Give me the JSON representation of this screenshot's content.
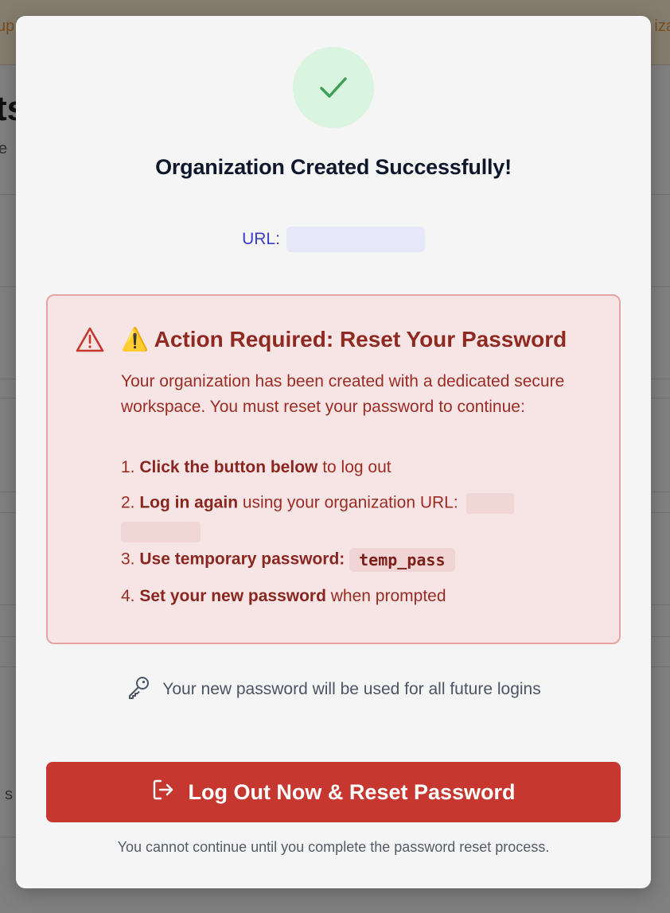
{
  "background": {
    "topbar_left_text": "up",
    "topbar_right_text": "iza",
    "heading_fragment": "ts",
    "sub_fragment": "e",
    "row_fragment": "s"
  },
  "modal": {
    "success_icon": "check-icon",
    "title": "Organization Created Successfully!",
    "url_label": "URL:",
    "alert": {
      "icon": "warning-triangle-icon",
      "title": "⚠️ Action Required: Reset Your Password",
      "body": "Your organization has been created with a dedicated secure workspace. You must reset your password to continue:",
      "steps": [
        {
          "num": "1.",
          "bold": "Click the button below",
          "rest": " to log out"
        },
        {
          "num": "2.",
          "bold": "Log in again",
          "rest": " using your organization URL:"
        },
        {
          "num": "3.",
          "bold": "Use temporary password:",
          "rest": ""
        },
        {
          "num": "4.",
          "bold": "Set your new password",
          "rest": " when prompted"
        }
      ],
      "temp_password": "temp_pass"
    },
    "info_text": "Your new password will be used for all future logins",
    "info_icon": "key-icon",
    "cta_label": "Log Out Now & Reset Password",
    "cta_icon": "logout-icon",
    "footnote": "You cannot continue until you complete the password reset process."
  },
  "colors": {
    "danger": "#c5372f",
    "success_bg": "#d9f4df",
    "success_check": "#3f9e57",
    "link": "#3b3fc4"
  }
}
